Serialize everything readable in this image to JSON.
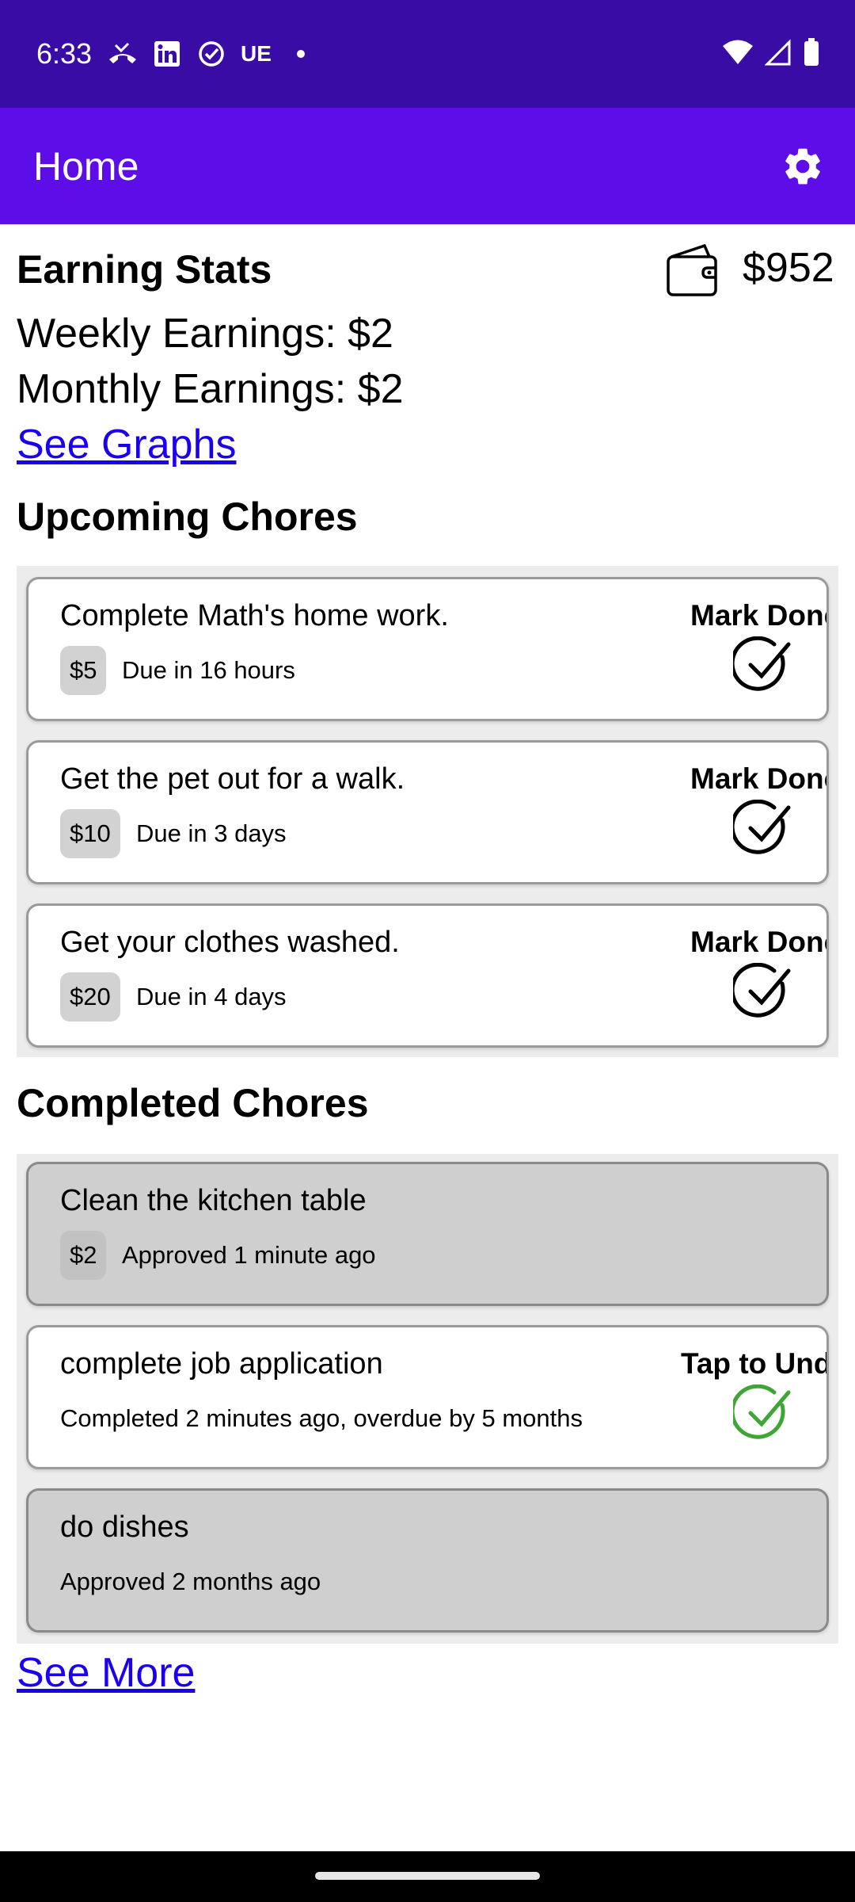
{
  "status_bar": {
    "time": "6:33",
    "ue_label": "UE",
    "icons_left": [
      "missed-call-icon",
      "linkedin-icon",
      "task-check-icon",
      "ue-icon",
      "dot-icon"
    ],
    "icons_right": [
      "wifi-icon",
      "signal-icon",
      "battery-icon"
    ]
  },
  "app_bar": {
    "title": "Home",
    "settings_icon": "gear-icon",
    "color": "#5c0de8"
  },
  "stats": {
    "title": "Earning Stats",
    "balance": "$952",
    "weekly": "Weekly Earnings: $2",
    "monthly": "Monthly Earnings: $2",
    "see_graphs": "See Graphs"
  },
  "upcoming": {
    "title": "Upcoming Chores",
    "items": [
      {
        "title": "Complete Math's home work.",
        "price": "$5",
        "due": "Due in 16 hours",
        "action": "Mark Done"
      },
      {
        "title": "Get the pet out for a walk.",
        "price": "$10",
        "due": "Due in 3 days",
        "action": "Mark Done"
      },
      {
        "title": "Get your clothes washed.",
        "price": "$20",
        "due": "Due in 4 days",
        "action": "Mark Done"
      }
    ]
  },
  "completed": {
    "title": "Completed Chores",
    "items": [
      {
        "title": "Clean the kitchen table",
        "price": "$2",
        "status": "Approved 1 minute ago"
      },
      {
        "title": "complete job application",
        "status": "Completed 2 minutes ago, overdue by 5 months",
        "action": "Tap to Undo"
      },
      {
        "title": "do dishes",
        "status": "Approved 2 months ago"
      }
    ],
    "see_more": "See More"
  },
  "colors": {
    "status_bar": "#3a0ca6",
    "link": "#1a00ee",
    "check_green": "#3fa535"
  }
}
